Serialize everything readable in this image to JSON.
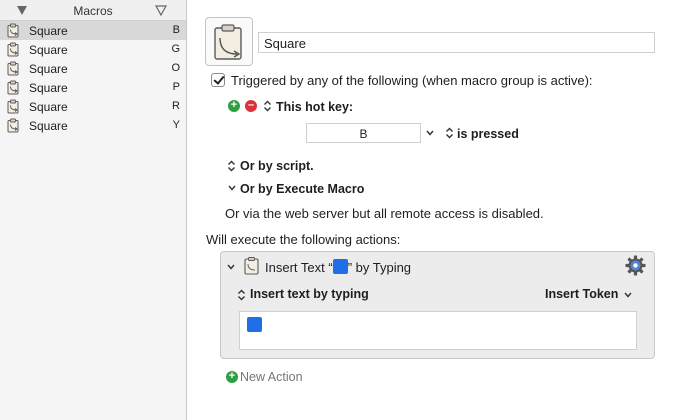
{
  "sidebar": {
    "header_title": "Macros",
    "macros": [
      {
        "name": "Square",
        "key": "B",
        "selected": true
      },
      {
        "name": "Square",
        "key": "G",
        "selected": false
      },
      {
        "name": "Square",
        "key": "O",
        "selected": false
      },
      {
        "name": "Square",
        "key": "P",
        "selected": false
      },
      {
        "name": "Square",
        "key": "R",
        "selected": false
      },
      {
        "name": "Square",
        "key": "Y",
        "selected": false
      }
    ]
  },
  "editor": {
    "macro_name": "Square",
    "trigger_label": "Triggered by any of the following (when macro group is active):",
    "hotkey_label": "This hot key:",
    "hotkey_value": "B",
    "hotkey_condition": "is pressed",
    "by_script_label": "Or by script.",
    "by_execute_label": "Or by Execute Macro",
    "web_server_note": "Or via the web server but all remote access is disabled.",
    "will_execute_label": "Will execute the following actions:",
    "action": {
      "title_prefix": "Insert Text “",
      "title_suffix": "” by Typing",
      "mode_label": "Insert text by typing",
      "insert_token_label": "Insert Token"
    },
    "new_action_label": "New Action"
  },
  "colors": {
    "square_blue": "#1f6fe8",
    "add_green": "#2ea043",
    "remove_red": "#d8333a",
    "selection_gray": "#d8d8d8"
  },
  "icons": [
    "clipboard-icon",
    "gear-icon",
    "chevron-down-icon",
    "up-down-arrows-icon",
    "add-icon",
    "remove-icon"
  ]
}
